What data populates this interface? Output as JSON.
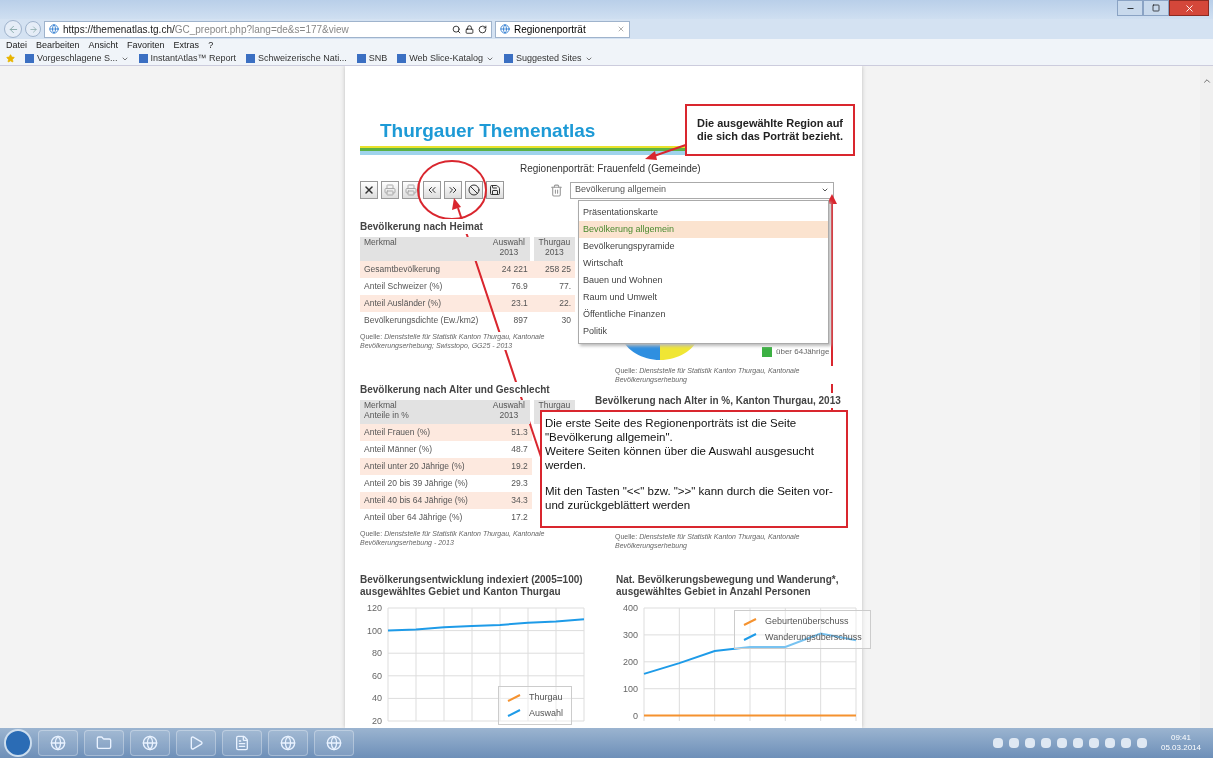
{
  "browser": {
    "address_host": "https://themenatlas.tg.ch/",
    "address_path": "GC_preport.php?lang=de&s=177&view",
    "tabs": [
      {
        "title": "Regionenporträt",
        "selected": true
      }
    ],
    "menu": [
      "Datei",
      "Bearbeiten",
      "Ansicht",
      "Favoriten",
      "Extras",
      "?"
    ],
    "favorites": [
      {
        "label": "Vorgeschlagene S...",
        "dropdown": true
      },
      {
        "label": "InstantAtlas™ Report",
        "dropdown": false
      },
      {
        "label": "Schweizerische Nati...",
        "dropdown": false
      },
      {
        "label": "SNB",
        "dropdown": false
      },
      {
        "label": "Web Slice-Katalog",
        "dropdown": true
      },
      {
        "label": "Suggested Sites",
        "dropdown": true
      }
    ]
  },
  "page": {
    "title": "Thurgauer Themenatlas",
    "subtitle": "Regionenporträt: Frauenfeld (Gemeinde)",
    "page_select": {
      "value": "Bevölkerung allgemein",
      "expanded": true,
      "options": [
        {
          "label": "Präsentationskarte",
          "selected": false
        },
        {
          "label": "Bevölkerung allgemein",
          "selected": true
        },
        {
          "label": "Bevölkerungspyramide",
          "selected": false
        },
        {
          "label": "Wirtschaft",
          "selected": false
        },
        {
          "label": "Bauen und Wohnen",
          "selected": false
        },
        {
          "label": "Raum und Umwelt",
          "selected": false
        },
        {
          "label": "Öffentliche Finanzen",
          "selected": false
        },
        {
          "label": "Politik",
          "selected": false
        }
      ]
    },
    "tables": [
      {
        "heading": "Bevölkerung nach Heimat",
        "columns": [
          {
            "label": "Merkmal"
          },
          {
            "label": "Auswahl",
            "sub": "2013"
          },
          {
            "label": "Thurgau",
            "sub": "2013"
          }
        ],
        "rows": [
          [
            "Gesamtbevölkerung",
            "24 221",
            "258 25"
          ],
          [
            "Anteil Schweizer (%)",
            "76.9",
            "77."
          ],
          [
            "Anteil Ausländer (%)",
            "23.1",
            "22."
          ],
          [
            "Bevölkerungsdichte (Ew./km2)",
            "897",
            "30"
          ]
        ],
        "source": "Quelle: *Dienststelle für Statistik Kanton Thurgau, Kantonale Bevölkerungserhebung; Swisstopo, GG25 - 2013*"
      },
      {
        "heading": "Bevölkerung nach Alter und Geschlecht",
        "columns": [
          {
            "label": "Merkmal",
            "sub": "Anteile in %"
          },
          {
            "label": "Auswahl",
            "sub": "2013"
          },
          {
            "label": "Thurgau"
          }
        ],
        "rows": [
          [
            "Anteil Frauen (%)",
            "51.3"
          ],
          [
            "Anteil Männer (%)",
            "48.7"
          ],
          [
            "Anteil unter 20 Jährige (%)",
            "19.2"
          ],
          [
            "Anteil 20 bis 39 Jährige (%)",
            "29.3"
          ],
          [
            "Anteil 40 bis 64 Jährige (%)",
            "34.3"
          ],
          [
            "Anteil über 64 Jährige (%)",
            "17.2"
          ]
        ],
        "source": "Quelle: *Dienststelle für Statistik Kanton Thurgau, Kantonale Bevölkerungserhebung - 2013*"
      }
    ],
    "pie_legend": {
      "label": "über 64Jährige",
      "color": "#3cb043"
    },
    "pie_source": "Quelle: *Dienststelle für Statistik Kanton Thurgau, Kantonale Bevölkerungserhebung*",
    "age_heading": "Bevölkerung nach Alter in %, Kanton Thurgau, 2013",
    "age_source": "Quelle: *Dienststelle für Statistik Kanton Thurgau, Kantonale Bevölkerungserhebung*",
    "charts": [
      {
        "chart_data": {
          "type": "line",
          "title": "Bevölkerungsentwicklung indexiert (2005=100) ausgewähltes Gebiet und Kanton Thurgau",
          "ylim": [
            20,
            120
          ],
          "yticks": [
            20,
            40,
            60,
            80,
            100,
            120
          ],
          "grid": true,
          "legend": true,
          "series": [
            {
              "name": "Thurgau",
              "color": "#f5922f",
              "values": [
                null,
                null,
                null,
                null,
                null,
                null,
                null,
                null
              ]
            },
            {
              "name": "Auswahl",
              "color": "#1e9be8",
              "values": [
                100,
                101,
                103,
                104,
                105,
                107,
                108,
                110
              ]
            }
          ]
        }
      },
      {
        "chart_data": {
          "type": "line",
          "title": "Nat. Bevölkerungsbewegung und Wanderung*, ausgewähltes Gebiet in Anzahl Personen",
          "ylim": [
            -20,
            400
          ],
          "yticks": [
            0,
            100,
            200,
            300,
            400
          ],
          "grid": true,
          "legend": true,
          "series": [
            {
              "name": "Geburtenüberschuss",
              "color": "#f5922f",
              "values": [
                0,
                0,
                0,
                0,
                0,
                0,
                0
              ]
            },
            {
              "name": "Wanderungsüberschuss",
              "color": "#1e9be8",
              "values": [
                155,
                195,
                240,
                255,
                255,
                305,
                280
              ]
            }
          ]
        }
      }
    ]
  },
  "annotations": [
    {
      "text": "Die ausgewählte Region auf die sich das Porträt bezieht."
    },
    {
      "paragraphs": [
        "Die erste Seite des Regionenporträts ist die Seite \"Bevölkerung allgemein\".",
        "Weitere Seiten können über die Auswahl ausgesucht werden.",
        "Mit den Tasten \"<<\" bzw. \">>\" kann durch die Seiten vor- und zurückgeblättert werden"
      ]
    }
  ],
  "taskbar": {
    "time": "09:41",
    "date": "05.03.2014"
  }
}
